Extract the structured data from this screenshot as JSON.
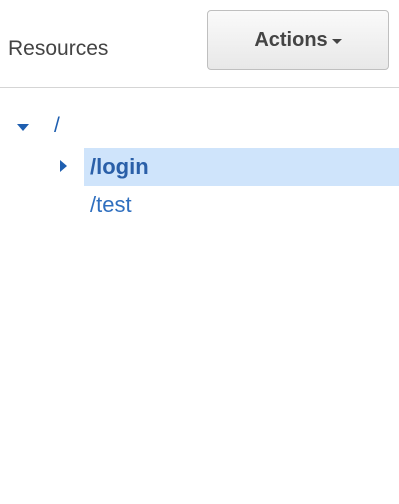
{
  "header": {
    "title": "Resources",
    "actions_label": "Actions"
  },
  "tree": {
    "root": {
      "label": "/",
      "expanded": true
    },
    "children": [
      {
        "label": "/login",
        "selected": true,
        "expandable": true
      },
      {
        "label": "/test",
        "selected": false,
        "expandable": false
      }
    ]
  },
  "colors": {
    "link": "#1f5fb0",
    "selection": "#cfe4fb",
    "text": "#444444"
  },
  "icons": {
    "root_toggle": "caret-down-icon",
    "child_toggle": "caret-right-icon",
    "actions_caret": "caret-down-icon"
  }
}
